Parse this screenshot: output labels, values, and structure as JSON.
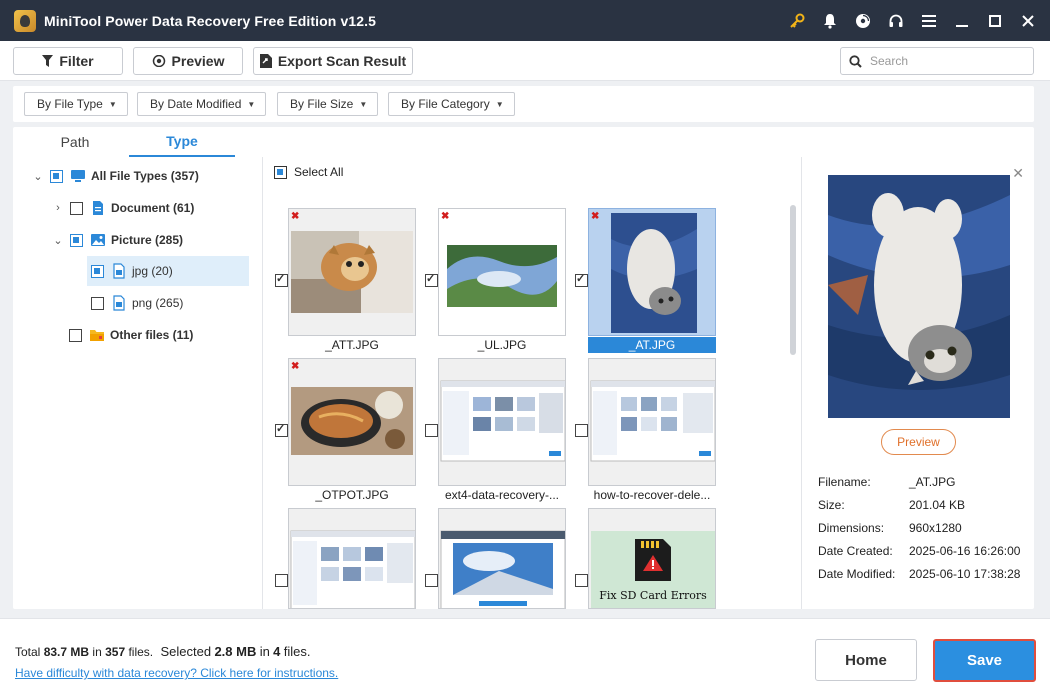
{
  "app": {
    "title": "MiniTool Power Data Recovery Free Edition v12.5"
  },
  "titlebar_icons": [
    "key-icon",
    "bell-icon",
    "disc-icon",
    "headset-icon",
    "menu-icon",
    "minimize-icon",
    "maximize-icon",
    "close-icon"
  ],
  "toolbar": {
    "filter_label": "Filter",
    "preview_label": "Preview",
    "export_label": "Export Scan Result",
    "search_placeholder": "Search"
  },
  "filters": [
    "By File Type",
    "By Date Modified",
    "By File Size",
    "By File Category"
  ],
  "tabs": [
    "Path",
    "Type"
  ],
  "tree": [
    {
      "label": "All File Types (357)"
    },
    {
      "label": "Document (61)"
    },
    {
      "label": "Picture (285)"
    },
    {
      "label": "jpg (20)"
    },
    {
      "label": "png (265)"
    },
    {
      "label": "Other files (11)"
    }
  ],
  "grid": {
    "select_all_label": "Select All",
    "items": [
      {
        "name": "_ATT.JPG",
        "checked": true,
        "deleted": true
      },
      {
        "name": "_UL.JPG",
        "checked": true,
        "deleted": true
      },
      {
        "name": "_AT.JPG",
        "checked": true,
        "deleted": true,
        "selected": true
      },
      {
        "name": "_OTPOT.JPG",
        "checked": true,
        "deleted": true
      },
      {
        "name": "ext4-data-recovery-...",
        "checked": false,
        "deleted": false
      },
      {
        "name": "how-to-recover-dele...",
        "checked": false,
        "deleted": false
      },
      {
        "name": "",
        "checked": false,
        "deleted": false
      },
      {
        "name": "",
        "checked": false,
        "deleted": false
      },
      {
        "name": "",
        "checked": false,
        "deleted": false,
        "caption": "Fix SD Card Errors"
      }
    ]
  },
  "preview": {
    "button_label": "Preview",
    "fields": [
      {
        "key": "Filename:",
        "value": "_AT.JPG"
      },
      {
        "key": "Size:",
        "value": "201.04 KB"
      },
      {
        "key": "Dimensions:",
        "value": "960x1280"
      },
      {
        "key": "Date Created:",
        "value": "2025-06-16 16:26:00"
      },
      {
        "key": "Date Modified:",
        "value": "2025-06-10 17:38:28"
      }
    ]
  },
  "bottom": {
    "total_prefix": "Total",
    "total_size": "83.7 MB",
    "in1": "in",
    "total_files": "357",
    "files1": "files.",
    "selected_prefix": "Selected",
    "selected_size": "2.8 MB",
    "in2": "in",
    "selected_files": "4",
    "files2": "files.",
    "help_link": "Have difficulty with data recovery? Click here for instructions.",
    "home_label": "Home",
    "save_label": "Save"
  },
  "colors": {
    "titlebar": "#2a3342",
    "accent": "#2b88d8",
    "save_border": "#e04e3e",
    "preview_button": "#e0702a"
  }
}
